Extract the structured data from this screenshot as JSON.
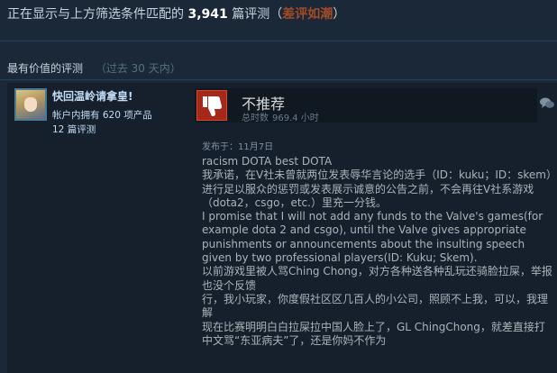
{
  "summary": {
    "prefix": "正在显示与上方筛选条件匹配的",
    "count": "3,941",
    "suffix": "篇评测",
    "open_paren": "（",
    "rating": "差评如潮",
    "close_paren": "）"
  },
  "section": {
    "title": "最有价值的评测",
    "period": "（过去 30 天内）"
  },
  "review": {
    "author_name": "快回温岭请拿皇!",
    "products_owned": "帐户内拥有 620 项产品",
    "review_count": "12 篇评测",
    "recommendation": "不推荐",
    "hours_label": "总时数",
    "hours_value": "969.4 小时",
    "posted_date": "发布于：11月7日",
    "thumb_color": "#a5281a",
    "content_lines": [
      "racism DOTA best DOTA",
      "我承诺，在V社未曾就两位发表辱华言论的选手（ID：kuku；ID：skem）进行足以服众的惩罚或发表展示诚意的公告之前，不会再往V社系游戏（dota2，csgo，etc.）里充一分钱。",
      "I promise that I will not add any funds to the Valve's games(for example dota 2 and csgo), until the Valve gives appropriate punishments or announcements about the insulting speech given by two professional players(ID: Kuku; Skem).",
      "以前游戏里被人骂Ching Chong，对方各种送各种乱玩还骑脸拉屎，举报也没个反馈",
      "行，我小玩家，你度假社区区几百人的小公司，照顾不上我，可以，我理解",
      "现在比赛明明白白拉屎拉中国人脸上了，GL ChingChong，就差直接打中文骂“东亚病夫”了，还是你妈不作为"
    ]
  },
  "icons": {
    "thumb": "thumbs-down-icon",
    "comment": "comment-bubble-icon"
  }
}
